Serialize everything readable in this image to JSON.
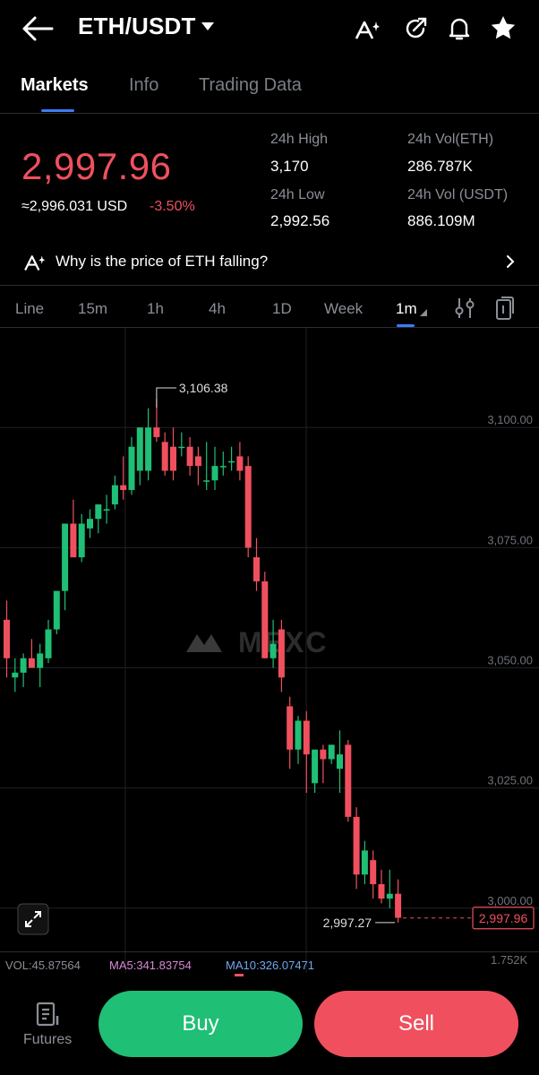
{
  "header": {
    "title": "ETH/USDT",
    "icons": [
      "back-arrow-icon",
      "caret-down-icon",
      "ai-icon",
      "share-icon",
      "bell-icon",
      "star-icon"
    ]
  },
  "tabs": [
    {
      "label": "Markets",
      "active": true
    },
    {
      "label": "Info",
      "active": false
    },
    {
      "label": "Trading Data",
      "active": false
    }
  ],
  "ticker": {
    "last_price": "2,997.96",
    "usd_equiv": "≈2,996.031 USD",
    "change": "-3.50%",
    "high_label": "24h High",
    "high": "3,170",
    "low_label": "24h Low",
    "low": "2,992.56",
    "vol_eth_label": "24h Vol(ETH)",
    "vol_eth": "286.787K",
    "vol_usdt_label": "24h Vol (USDT)",
    "vol_usdt": "886.109M"
  },
  "insight": {
    "text": "Why is the price of ETH falling?"
  },
  "intervals": [
    {
      "label": "Line"
    },
    {
      "label": "15m"
    },
    {
      "label": "1h"
    },
    {
      "label": "4h"
    },
    {
      "label": "1D"
    },
    {
      "label": "Week"
    },
    {
      "label": "1m",
      "active": true
    }
  ],
  "chart_data": {
    "type": "candlestick",
    "y_ticks": [
      "3,100.00",
      "3,075.00",
      "3,050.00",
      "3,025.00",
      "3,000.00"
    ],
    "ylim": [
      2994,
      3117
    ],
    "max_label": "3,106.38",
    "min_label": "2,997.27",
    "last_price_label": "2,997.96",
    "watermark": "MEXC",
    "candles": [
      [
        3060,
        3064,
        3048,
        3052
      ],
      [
        3048,
        3052,
        3045,
        3049
      ],
      [
        3049,
        3053,
        3046,
        3052
      ],
      [
        3052,
        3056,
        3050,
        3050
      ],
      [
        3050,
        3055,
        3046,
        3053
      ],
      [
        3052,
        3060,
        3051,
        3058
      ],
      [
        3058,
        3066,
        3057,
        3066
      ],
      [
        3066,
        3080,
        3062,
        3080
      ],
      [
        3080,
        3085,
        3073,
        3073
      ],
      [
        3073,
        3082,
        3072,
        3080
      ],
      [
        3079,
        3083,
        3077,
        3081
      ],
      [
        3081,
        3084,
        3078,
        3084
      ],
      [
        3083,
        3086,
        3080,
        3083
      ],
      [
        3084,
        3090,
        3083,
        3088
      ],
      [
        3088,
        3094,
        3085,
        3087
      ],
      [
        3087,
        3098,
        3086,
        3096
      ],
      [
        3091,
        3100,
        3088,
        3100
      ],
      [
        3091,
        3104,
        3089,
        3100
      ],
      [
        3100,
        3106,
        3097,
        3098
      ],
      [
        3097,
        3099,
        3090,
        3091
      ],
      [
        3096,
        3100,
        3089,
        3091
      ],
      [
        3096,
        3099,
        3094,
        3096
      ],
      [
        3096,
        3098,
        3090,
        3092
      ],
      [
        3094,
        3096,
        3088,
        3092
      ],
      [
        3089,
        3097,
        3087,
        3089
      ],
      [
        3089,
        3096,
        3087,
        3092
      ],
      [
        3092,
        3095,
        3090,
        3092
      ],
      [
        3093,
        3096,
        3091,
        3093
      ],
      [
        3094,
        3097,
        3089,
        3091
      ],
      [
        3092,
        3094,
        3073,
        3075
      ],
      [
        3073,
        3077,
        3066,
        3068
      ],
      [
        3068,
        3070,
        3052,
        3052
      ],
      [
        3052,
        3060,
        3050,
        3055
      ],
      [
        3058,
        3060,
        3045,
        3048
      ],
      [
        3042,
        3044,
        3029,
        3033
      ],
      [
        3033,
        3040,
        3030,
        3039
      ],
      [
        3039,
        3041,
        3024,
        3032
      ],
      [
        3026,
        3030,
        3024,
        3033
      ],
      [
        3033,
        3034,
        3026,
        3031
      ],
      [
        3031,
        3034,
        3030,
        3034
      ],
      [
        3029,
        3037,
        3024,
        3032
      ],
      [
        3034,
        3035,
        3018,
        3019
      ],
      [
        3019,
        3021,
        3004,
        3007
      ],
      [
        3007,
        3014,
        3005,
        3012
      ],
      [
        3010,
        3012,
        3002,
        3005
      ],
      [
        3005,
        3008,
        3001,
        3002
      ],
      [
        3002,
        3008,
        3000,
        3003
      ],
      [
        3003,
        3006,
        2997,
        2998
      ]
    ]
  },
  "indicators": {
    "vol": "VOL:45.87564",
    "ma5": "MA5:341.83754",
    "ma10": "MA10:326.07471",
    "vol_axis": "1.752K"
  },
  "colors": {
    "up": "#1fbf75",
    "down": "#f0505e",
    "accent": "#3f7bf5"
  },
  "footer": {
    "futures": "Futures",
    "buy": "Buy",
    "sell": "Sell"
  }
}
